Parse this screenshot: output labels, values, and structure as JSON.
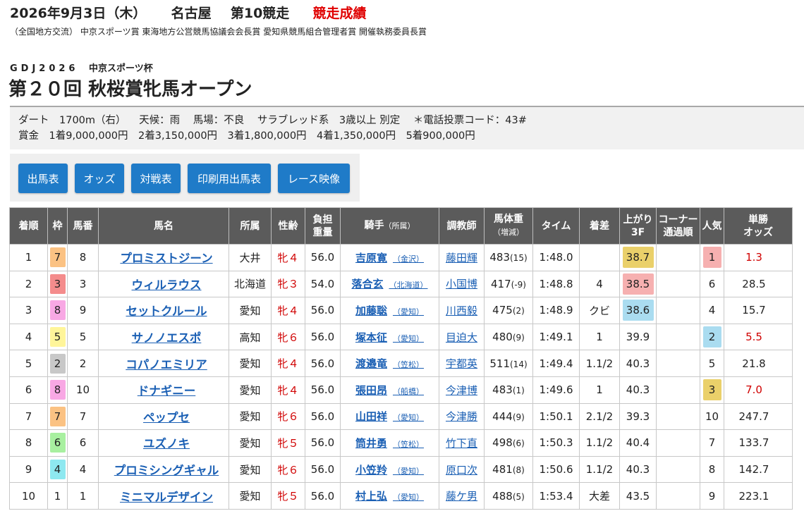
{
  "header": {
    "date": "2026年9月3日（木）",
    "venue": "名古屋",
    "race_no": "第10競走",
    "status": "競走成績"
  },
  "sponsors": "（全国地方交流） 中京スポーツ賞 東海地方公営競馬協議会会長賞 愛知県競馬組合管理者賞 開催執務委員長賞",
  "grade": {
    "code": "GDJ2026",
    "cup": "中京スポーツ杯"
  },
  "race_title": "第２０回 秋桜賞牝馬オープン",
  "info": {
    "course": "ダート　1700m（右）",
    "weather": "天候：雨",
    "track": "馬場：不良",
    "condition": "サラブレッド系　3歳以上 別定",
    "phone_code": "＊電話投票コード：43#",
    "prize": "賞金　1着9,000,000円　2着3,150,000円　3着1,800,000円　4着1,350,000円　5着900,000円"
  },
  "buttons": [
    "出馬表",
    "オッズ",
    "対戦表",
    "印刷用出馬表",
    "レース映像"
  ],
  "colors": {
    "button": "#1f7bc8",
    "header_bg": "#5b5b5b",
    "frames": {
      "1": "#ffffff",
      "2": "#c8c8c8",
      "3": "#f48c8c",
      "4": "#8ee8f0",
      "5": "#fff59a",
      "6": "#a8f0a0",
      "7": "#fbc283",
      "8": "#f8a8e4"
    },
    "highlight_pink": "#f6b0b0",
    "highlight_blue": "#aadcf0",
    "highlight_gold": "#ead06a"
  },
  "table": {
    "headers": {
      "rank": "着順",
      "frame": "枠",
      "num": "馬番",
      "horse": "馬名",
      "affil": "所属",
      "sexage": "性齢",
      "weight_a": "負担",
      "weight_b": "重量",
      "jockey": "騎手",
      "jockey_sub": "（所属）",
      "trainer": "調教師",
      "bw_a": "馬体重",
      "bw_b": "（増減）",
      "time": "タイム",
      "margin": "着差",
      "last3f_a": "上がり",
      "last3f_b": "3F",
      "corner_a": "コーナー",
      "corner_b": "通過順",
      "pop": "人気",
      "odds_a": "単勝",
      "odds_b": "オッズ"
    },
    "rows": [
      {
        "rank": "1",
        "frame": "7",
        "num": "8",
        "horse": "プロミストジーン",
        "affil": "大井",
        "sexage": "牝４",
        "weight": "56.0",
        "jockey": "吉原寛",
        "jockey_base": "（金沢）",
        "trainer": "藤田輝",
        "bw": "483",
        "bw_diff": "(15)",
        "time": "1:48.0",
        "margin": "",
        "last3f": "38.7",
        "last3f_hl": "gold",
        "corner": "",
        "pop": "1",
        "pop_hl": "pink",
        "odds": "1.3",
        "odds_red": true
      },
      {
        "rank": "2",
        "frame": "3",
        "num": "3",
        "horse": "ウィルラウス",
        "affil": "北海道",
        "sexage": "牝３",
        "weight": "54.0",
        "jockey": "落合玄",
        "jockey_base": "（北海道）",
        "trainer": "小国博",
        "bw": "417",
        "bw_diff": "(-9)",
        "time": "1:48.8",
        "margin": "4",
        "last3f": "38.5",
        "last3f_hl": "pink",
        "corner": "",
        "pop": "6",
        "pop_hl": "",
        "odds": "28.5",
        "odds_red": false
      },
      {
        "rank": "3",
        "frame": "8",
        "num": "9",
        "horse": "セットクルール",
        "affil": "愛知",
        "sexage": "牝４",
        "weight": "56.0",
        "jockey": "加藤聡",
        "jockey_base": "（愛知）",
        "trainer": "川西毅",
        "bw": "475",
        "bw_diff": "(2)",
        "time": "1:48.9",
        "margin": "クビ",
        "last3f": "38.6",
        "last3f_hl": "blue",
        "corner": "",
        "pop": "4",
        "pop_hl": "",
        "odds": "15.7",
        "odds_red": false
      },
      {
        "rank": "4",
        "frame": "5",
        "num": "5",
        "horse": "サノノエスポ",
        "affil": "高知",
        "sexage": "牝６",
        "weight": "56.0",
        "jockey": "塚本征",
        "jockey_base": "（愛知）",
        "trainer": "目迫大",
        "bw": "480",
        "bw_diff": "(9)",
        "time": "1:49.1",
        "margin": "1",
        "last3f": "39.9",
        "last3f_hl": "",
        "corner": "",
        "pop": "2",
        "pop_hl": "blue",
        "odds": "5.5",
        "odds_red": true
      },
      {
        "rank": "5",
        "frame": "2",
        "num": "2",
        "horse": "コパノエミリア",
        "affil": "愛知",
        "sexage": "牝４",
        "weight": "56.0",
        "jockey": "渡邉竜",
        "jockey_base": "（笠松）",
        "trainer": "宇都英",
        "bw": "511",
        "bw_diff": "(14)",
        "time": "1:49.4",
        "margin": "1.1/2",
        "last3f": "40.3",
        "last3f_hl": "",
        "corner": "",
        "pop": "5",
        "pop_hl": "",
        "odds": "21.8",
        "odds_red": false
      },
      {
        "rank": "6",
        "frame": "8",
        "num": "10",
        "horse": "ドナギニー",
        "affil": "愛知",
        "sexage": "牝４",
        "weight": "56.0",
        "jockey": "張田昂",
        "jockey_base": "（船橋）",
        "trainer": "今津博",
        "bw": "483",
        "bw_diff": "(1)",
        "time": "1:49.6",
        "margin": "1",
        "last3f": "40.3",
        "last3f_hl": "",
        "corner": "",
        "pop": "3",
        "pop_hl": "gold",
        "odds": "7.0",
        "odds_red": true
      },
      {
        "rank": "7",
        "frame": "7",
        "num": "7",
        "horse": "ペップセ",
        "affil": "愛知",
        "sexage": "牝６",
        "weight": "56.0",
        "jockey": "山田祥",
        "jockey_base": "（愛知）",
        "trainer": "今津勝",
        "bw": "444",
        "bw_diff": "(9)",
        "time": "1:50.1",
        "margin": "2.1/2",
        "last3f": "39.3",
        "last3f_hl": "",
        "corner": "",
        "pop": "10",
        "pop_hl": "",
        "odds": "247.7",
        "odds_red": false
      },
      {
        "rank": "8",
        "frame": "6",
        "num": "6",
        "horse": "ユズノキ",
        "affil": "愛知",
        "sexage": "牝５",
        "weight": "56.0",
        "jockey": "筒井勇",
        "jockey_base": "（笠松）",
        "trainer": "竹下直",
        "bw": "498",
        "bw_diff": "(6)",
        "time": "1:50.3",
        "margin": "1.1/2",
        "last3f": "40.4",
        "last3f_hl": "",
        "corner": "",
        "pop": "7",
        "pop_hl": "",
        "odds": "133.7",
        "odds_red": false
      },
      {
        "rank": "9",
        "frame": "4",
        "num": "4",
        "horse": "プロミシングギャル",
        "affil": "愛知",
        "sexage": "牝６",
        "weight": "56.0",
        "jockey": "小笠羚",
        "jockey_base": "（愛知）",
        "trainer": "原口次",
        "bw": "481",
        "bw_diff": "(8)",
        "time": "1:50.6",
        "margin": "1.1/2",
        "last3f": "40.3",
        "last3f_hl": "",
        "corner": "",
        "pop": "8",
        "pop_hl": "",
        "odds": "142.7",
        "odds_red": false
      },
      {
        "rank": "10",
        "frame": "1",
        "num": "1",
        "horse": "ミニマルデザイン",
        "affil": "愛知",
        "sexage": "牝５",
        "weight": "56.0",
        "jockey": "村上弘",
        "jockey_base": "（愛知）",
        "trainer": "藤ケ男",
        "bw": "488",
        "bw_diff": "(5)",
        "time": "1:53.4",
        "margin": "大差",
        "last3f": "43.5",
        "last3f_hl": "",
        "corner": "",
        "pop": "9",
        "pop_hl": "",
        "odds": "223.1",
        "odds_red": false
      }
    ]
  }
}
